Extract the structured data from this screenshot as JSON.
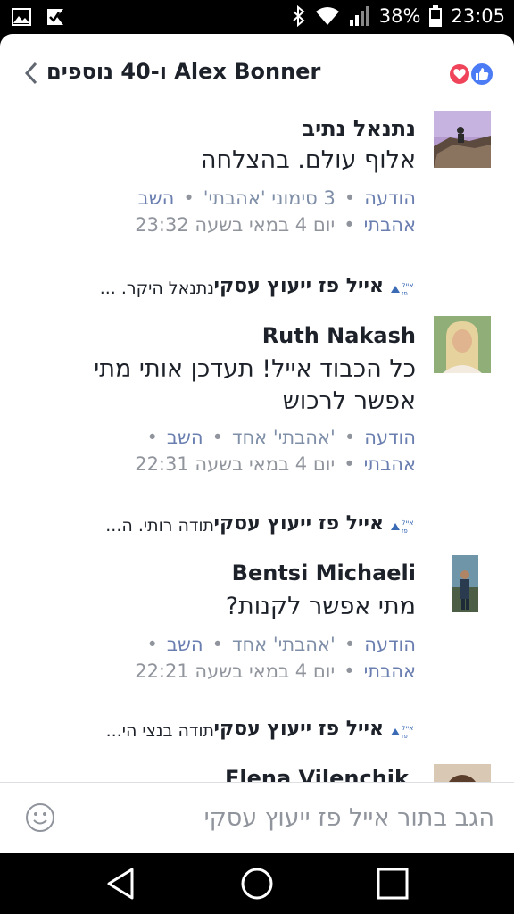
{
  "status_bar": {
    "battery": "38%",
    "time": "23:05",
    "icons": [
      "gallery-icon",
      "checkmark-flag-icon",
      "bluetooth-icon",
      "wifi-icon",
      "signal-icon",
      "battery-icon"
    ]
  },
  "header": {
    "title": "ו-40 נוספים Alex Bonner",
    "reactions": [
      "love-reaction-icon",
      "like-reaction-icon"
    ]
  },
  "comments": [
    {
      "author": "נתנאל נתיב",
      "text": "אלוף עולם. בהצלחה",
      "actions": [
        "הודעה",
        "3 סימוני 'אהבתי'",
        "השב"
      ],
      "like": "אהבתי",
      "time": "יום 4 במאי בשעה 23:32",
      "reply": {
        "name": "אייל פז ייעוץ עסקי",
        "text": "נתנאל היקר. ..."
      }
    },
    {
      "author": "Ruth Nakash",
      "text": "כל הכבוד אייל! תעדכן אותי מתי אפשר לרכוש",
      "actions": [
        "הודעה",
        "'אהבתי' אחד",
        "השב"
      ],
      "like": "אהבתי",
      "time": "יום 4 במאי בשעה 22:31",
      "reply": {
        "name": "אייל פז ייעוץ עסקי",
        "text": "תודה רותי. ה..."
      }
    },
    {
      "author": "Bentsi Michaeli",
      "text": "מתי אפשר לקנות?",
      "actions": [
        "הודעה",
        "'אהבתי' אחד",
        "השב"
      ],
      "like": "אהבתי",
      "time": "יום 4 במאי בשעה 22:21",
      "reply": {
        "name": "אייל פז ייעוץ עסקי",
        "text": "תודה בנצי הי..."
      }
    }
  ],
  "partial_comment": {
    "author": "Elena Vilenchik"
  },
  "composer": {
    "placeholder": "הגב בתור אייל פז ייעוץ עסקי"
  },
  "colors": {
    "link": "#6a7fb0",
    "like_blue": "#4c7cf5",
    "love_red": "#f0445a",
    "text": "#1d2129",
    "muted": "#90949c"
  }
}
